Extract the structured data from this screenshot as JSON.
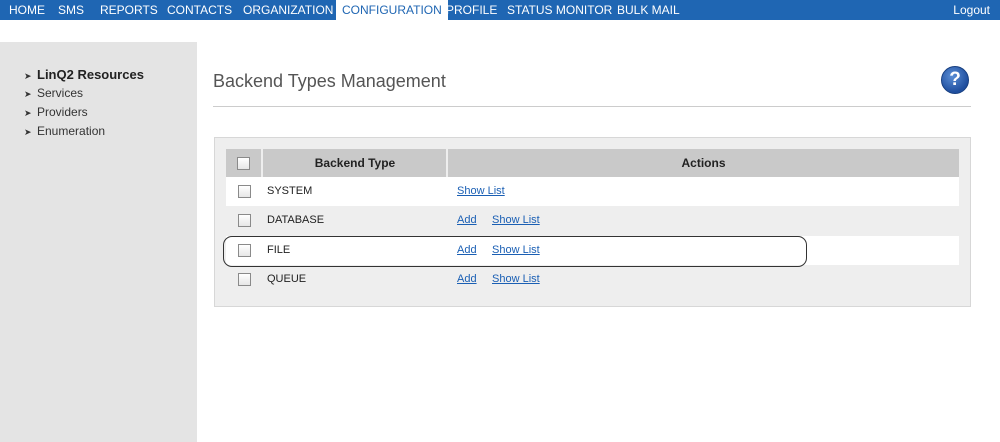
{
  "nav": {
    "items": [
      "HOME",
      "SMS",
      "REPORTS",
      "CONTACTS",
      "ORGANIZATION",
      "CONFIGURATION",
      "PROFILE",
      "STATUS MONITOR",
      "BULK MAIL"
    ],
    "active": "CONFIGURATION",
    "logout": "Logout"
  },
  "sidebar": {
    "items": [
      {
        "label": "LinQ2 Resources",
        "current": true
      },
      {
        "label": "Services"
      },
      {
        "label": "Providers"
      },
      {
        "label": "Enumeration"
      }
    ]
  },
  "page": {
    "title": "Backend Types Management",
    "help_icon": "question-mark-icon"
  },
  "table": {
    "headers": {
      "type": "Backend Type",
      "actions": "Actions"
    },
    "rows": [
      {
        "type": "SYSTEM",
        "actions": [
          "Show List"
        ]
      },
      {
        "type": "DATABASE",
        "actions": [
          "Add",
          "Show List"
        ]
      },
      {
        "type": "FILE",
        "actions": [
          "Add",
          "Show List"
        ],
        "highlighted": true
      },
      {
        "type": "QUEUE",
        "actions": [
          "Add",
          "Show List"
        ]
      }
    ]
  },
  "colors": {
    "nav_bg": "#1f66b3",
    "link": "#1a5fb4",
    "sidebar_bg": "#e4e4e4",
    "header_bg": "#c9c9c9"
  }
}
